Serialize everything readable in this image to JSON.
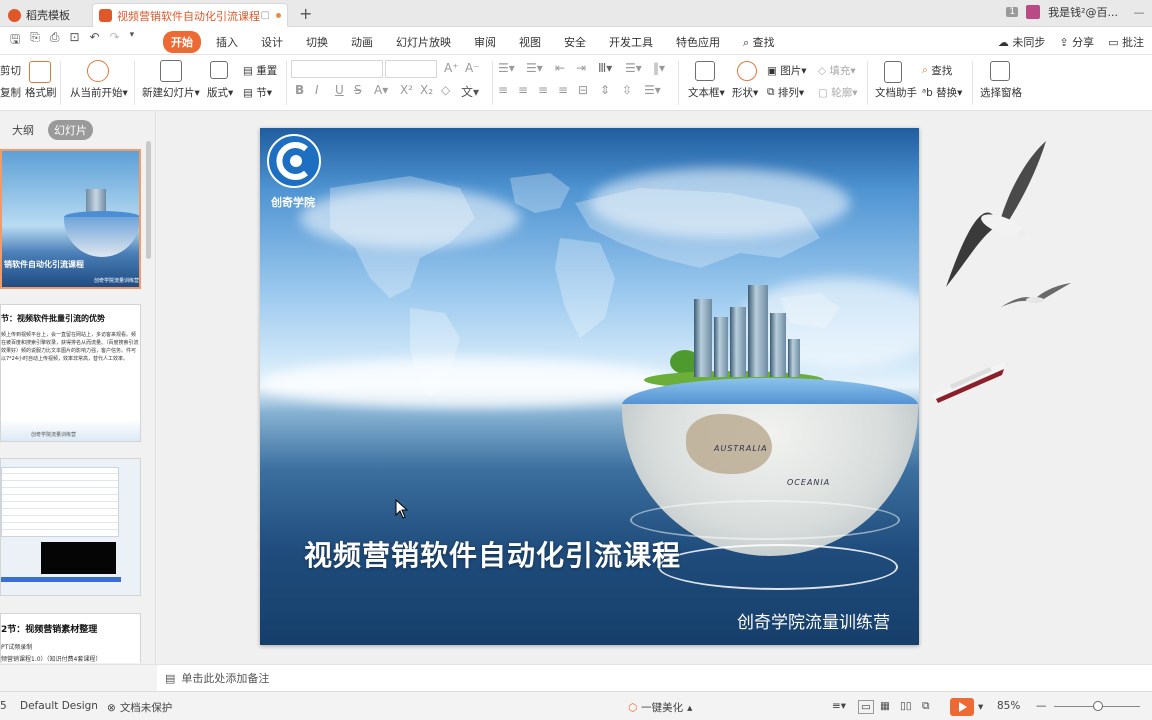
{
  "tabs": {
    "home": "稻壳模板",
    "doc": "视频营销软件自动化引流课程",
    "page_badge": "1",
    "user": "我是钱²@百..."
  },
  "menu": {
    "items": [
      "开始",
      "插入",
      "设计",
      "切换",
      "动画",
      "幻灯片放映",
      "审阅",
      "视图",
      "安全",
      "开发工具",
      "特色应用"
    ],
    "search": "查找",
    "sync": "未同步",
    "share": "分享",
    "comment": "批注"
  },
  "ribbon": {
    "cut": "剪切",
    "copy": "复制",
    "format_painter": "格式刷",
    "from_current": "从当前开始",
    "new_slide": "新建幻灯片",
    "layout": "版式",
    "reset": "重置",
    "section": "节",
    "text_box": "文本框",
    "shape": "形状",
    "picture": "图片",
    "fill": "填充",
    "arrange": "排列",
    "outline": "轮廓",
    "find": "查找",
    "replace": "替换",
    "doc_helper": "文档助手",
    "select_pane": "选择窗格"
  },
  "left_pane": {
    "tab_outline": "大纲",
    "tab_slides": "幻灯片",
    "thumb1_title": "销软件自动化引流课程",
    "thumb1_sub": "创奇学院流量训练营",
    "thumb2_title": "节：视频软件批量引流的优势",
    "thumb2_body": "频上传到视频平台上，会一直留在网站上，多访客来观看。频在被百度和搜索引擎收录，获得排名从而流量。（百度搜索引流效果好）频的说服力比文本图片的影响力强，客户信务。件可以7*24小时自动上传视频，效率非常高，替代人工效率。",
    "thumb2_foot": "创奇学院流量训练营",
    "thumb4_title": "2节：视频营销素材整理",
    "thumb4_line1": "PT试频录制",
    "thumb4_line2": "频营销课程1.0）（知识付费4套课程）"
  },
  "slide": {
    "logo_text": "创奇学院",
    "title": "视频营销软件自动化引流课程",
    "subtitle": "创奇学院流量训练营",
    "globe_label_1": "AUSTRALIA",
    "globe_label_2": "OCEANIA"
  },
  "notes": {
    "placeholder": "单击此处添加备注"
  },
  "status": {
    "slide_num": "5",
    "theme": "Default Design",
    "protection": "文档未保护",
    "beautify": "一键美化",
    "zoom": "85%"
  },
  "colors": {
    "accent": "#ee6a34",
    "tab_active_text": "#e0582a",
    "sea_dark": "#163f6a",
    "sky_light": "#e7f3fc"
  }
}
